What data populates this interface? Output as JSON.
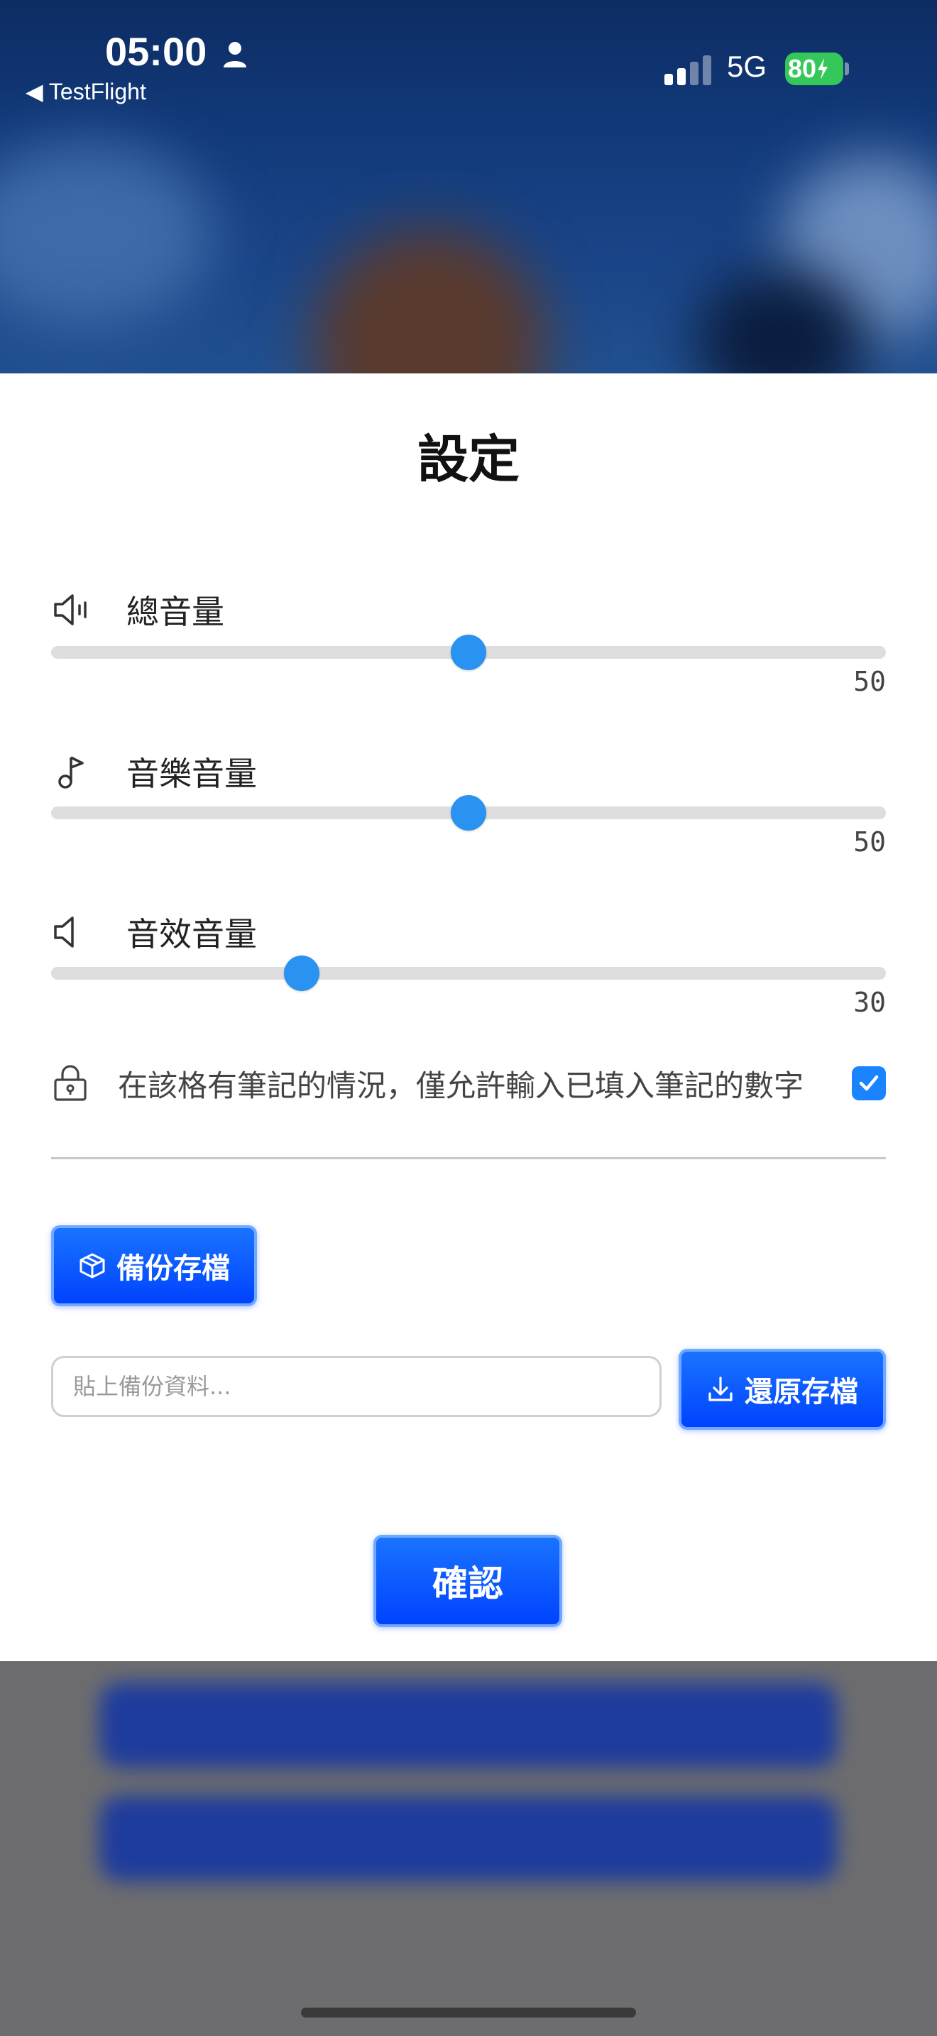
{
  "status_bar": {
    "time": "05:00",
    "back_label": "◀ TestFlight",
    "network": "5G",
    "battery": "80"
  },
  "settings": {
    "title": "設定",
    "sliders": [
      {
        "label": "總音量",
        "value": "50",
        "fraction": 0.5,
        "icon": "speaker-volume-icon"
      },
      {
        "label": "音樂音量",
        "value": "50",
        "fraction": 0.5,
        "icon": "music-note-icon"
      },
      {
        "label": "音效音量",
        "value": "30",
        "fraction": 0.3,
        "icon": "speaker-icon"
      }
    ],
    "notes_lock": {
      "label": "在該格有筆記的情況，僅允許輸入已填入筆記的數字",
      "checked": true,
      "icon": "lock-icon"
    },
    "backup_button": "備份存檔",
    "backup_input_placeholder": "貼上備份資料...",
    "restore_button": "還原存檔",
    "confirm_button": "確認"
  },
  "colors": {
    "accent": "#0a5cff",
    "slider_thumb": "#2a92f0",
    "checkbox": "#1a84ff",
    "battery": "#34c759"
  }
}
